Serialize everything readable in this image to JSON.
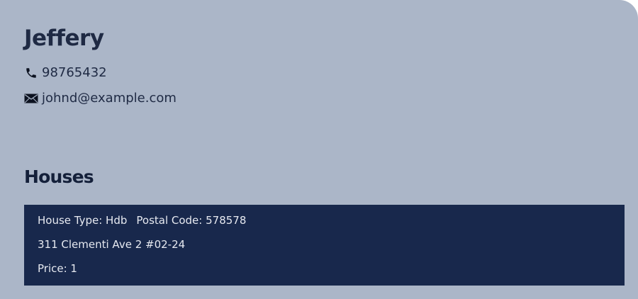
{
  "person": {
    "name": "Jeffery",
    "phone": "98765432",
    "email": "johnd@example.com",
    "phone_icon": "phone-icon",
    "email_icon": "envelope-icon"
  },
  "houses": {
    "title": "Houses",
    "items": [
      {
        "house_type": "House Type: Hdb",
        "postal_code": "Postal Code: 578578",
        "address": "311 Clementi Ave 2 #02-24",
        "price": "Price: 1"
      }
    ]
  },
  "colors": {
    "background": "#abb6c8",
    "card": "#18284c",
    "text_dark": "#1f2a44",
    "text_light": "#e6e9f0"
  }
}
